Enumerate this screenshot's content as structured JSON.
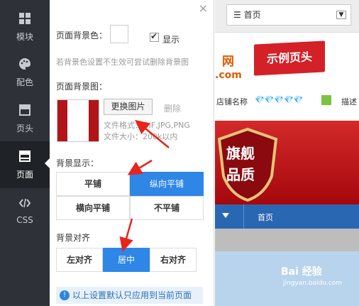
{
  "nav": {
    "items": [
      {
        "label": "模块",
        "icon": "grid-icon"
      },
      {
        "label": "配色",
        "icon": "palette-icon"
      },
      {
        "label": "页头",
        "icon": "header-icon"
      },
      {
        "label": "页面",
        "icon": "page-icon"
      },
      {
        "label": "CSS",
        "icon": "code-icon"
      }
    ],
    "active": "页面"
  },
  "panel": {
    "bg_color_label": "页面背景色：",
    "show_label": "显示",
    "bg_hint": "若背景色设置不生效可尝试删除背景图",
    "bg_image_label": "页面背景图：",
    "change_image": "更换图片",
    "delete": "删除",
    "file_format": "文件格式：GIF,JPG,PNG",
    "file_size": "文件大小：200k以内",
    "bg_display_label": "背景显示：",
    "display_options": [
      "平铺",
      "纵向平铺",
      "横向平铺",
      "不平铺"
    ],
    "display_selected": "纵向平铺",
    "align_label": "背景对齐",
    "align_options": [
      "左对齐",
      "居中",
      "右对齐"
    ],
    "align_selected": "居中",
    "info": "以上设置默认只应用到当前页面"
  },
  "preview": {
    "page_select": "首页",
    "logo_fragment_1": "网",
    "logo_fragment_2": ".com",
    "ribbon": "示例页头",
    "store_name": "店铺名称",
    "store_desc": "描述",
    "seal_line1": "旗舰",
    "seal_line2": "品质",
    "nav_home": "首页",
    "watermark": "Bai 经验",
    "watermark_url": "jingyan.baidu.com"
  },
  "colors": {
    "accent_blue": "#2e86e6",
    "nav_bg": "#2e32 38",
    "brand_red": "#d42127"
  }
}
